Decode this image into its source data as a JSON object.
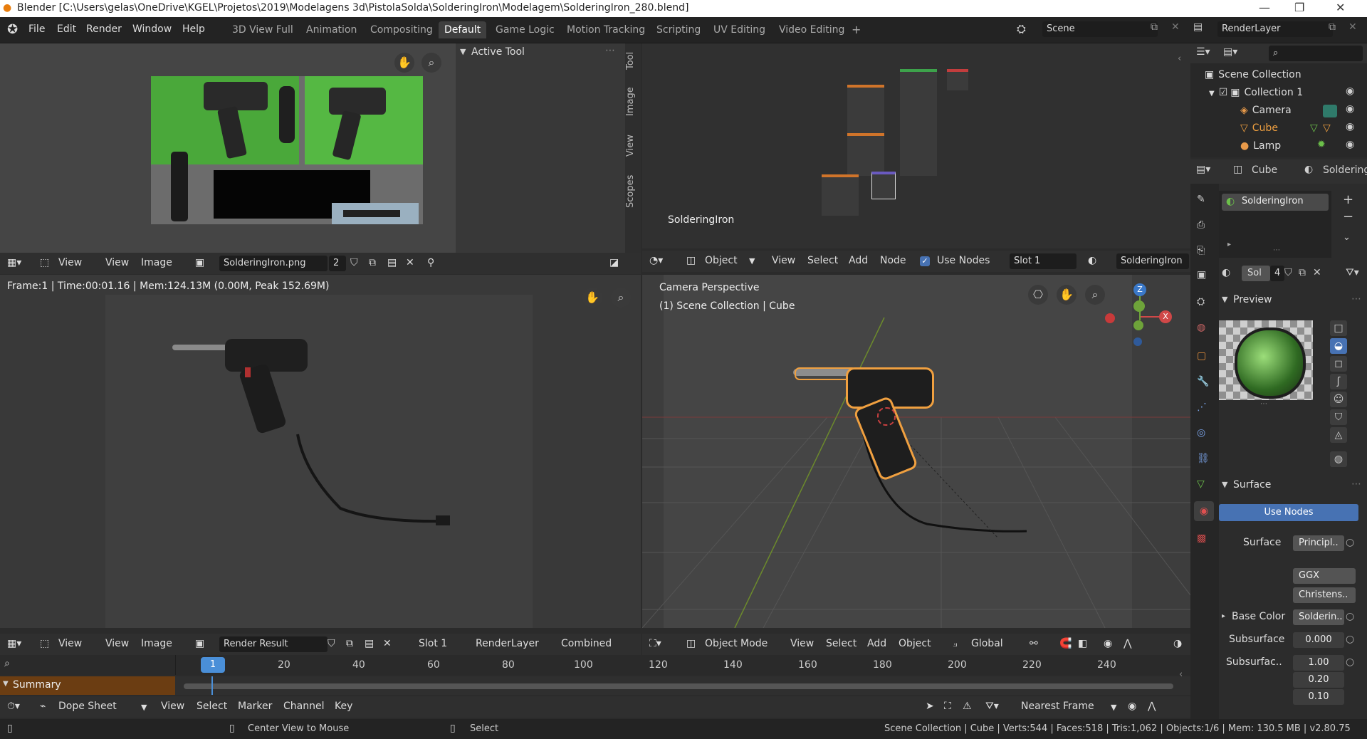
{
  "titlebar": {
    "title": "Blender [C:\\Users\\gelas\\OneDrive\\KGEL\\Projetos\\2019\\Modelagens 3d\\PistolaSolda\\SolderingIron\\Modelagem\\SolderingIron_280.blend]"
  },
  "menu": [
    "File",
    "Edit",
    "Render",
    "Window",
    "Help"
  ],
  "workspaces": [
    "3D View Full",
    "Animation",
    "Compositing",
    "Default",
    "Game Logic",
    "Motion Tracking",
    "Scripting",
    "UV Editing",
    "Video Editing"
  ],
  "workspace_active": "Default",
  "scene": {
    "label": "Scene",
    "renderlayer": "RenderLayer"
  },
  "image_editor_top": {
    "tool_panel_title": "Active Tool",
    "side_tabs": [
      "Tool",
      "Image",
      "View",
      "Scopes"
    ],
    "header": {
      "view1": "View",
      "view2": "View",
      "image": "Image",
      "image_name": "SolderingIron.png",
      "users": "2"
    }
  },
  "node_editor": {
    "material_label": "SolderingIron",
    "header": {
      "object": "Object",
      "view": "View",
      "select": "Select",
      "add": "Add",
      "node": "Node",
      "use_nodes": "Use Nodes",
      "slot": "Slot 1",
      "material": "SolderingIron"
    }
  },
  "render_view": {
    "info": "Frame:1 | Time:00:01.16 | Mem:124.13M (0.00M, Peak 152.69M)",
    "header": {
      "view1": "View",
      "view2": "View",
      "image": "Image",
      "image_name": "Render Result",
      "slot": "Slot 1",
      "layer": "RenderLayer",
      "pass": "Combined"
    }
  },
  "viewport": {
    "title": "Camera Perspective",
    "subtitle": "(1) Scene Collection | Cube",
    "header": {
      "mode": "Object Mode",
      "view": "View",
      "select": "Select",
      "add": "Add",
      "object": "Object",
      "orientation": "Global"
    },
    "gizmo": {
      "z": "Z",
      "x": "X"
    }
  },
  "outliner": {
    "items": [
      {
        "label": "Scene Collection",
        "color": "#dddddd"
      },
      {
        "label": "Collection 1",
        "color": "#dddddd"
      },
      {
        "label": "Camera",
        "color": "#dddddd"
      },
      {
        "label": "Cube",
        "color": "#f0a040"
      },
      {
        "label": "Lamp",
        "color": "#dddddd"
      }
    ]
  },
  "properties": {
    "breadcrumb": {
      "object": "Cube",
      "material": "Soldering"
    },
    "material_slot": "SolderingIron",
    "datablock_name": "Sol",
    "datablock_users": "4",
    "preview_title": "Preview",
    "surface_title": "Surface",
    "use_nodes_btn": "Use Nodes",
    "rows": [
      {
        "label": "Surface",
        "value": "Principl.."
      },
      {
        "label": "",
        "value": "GGX"
      },
      {
        "label": "",
        "value": "Christens.."
      },
      {
        "label": "Base Color",
        "value": "Solderin.."
      },
      {
        "label": "Subsurface",
        "value": "0.000"
      },
      {
        "label": "Subsurfac..",
        "value": "1.00"
      },
      {
        "label": "",
        "value": "0.20"
      },
      {
        "label": "",
        "value": "0.10"
      }
    ]
  },
  "timeline": {
    "current_frame": "1",
    "ticks": [
      "20",
      "40",
      "60",
      "80",
      "100",
      "120",
      "140",
      "160",
      "180",
      "200",
      "220",
      "240"
    ],
    "summary": "Summary"
  },
  "dopesheet": {
    "editor": "Dope Sheet",
    "menu": [
      "View",
      "Select",
      "Marker",
      "Channel",
      "Key"
    ],
    "snap": "Nearest Frame"
  },
  "status": {
    "center": "Center View to Mouse",
    "select": "Select",
    "stats": "Scene Collection | Cube | Verts:544 | Faces:518 | Tris:1,062 | Objects:1/6 | Mem: 130.5 MB | v2.80.75"
  },
  "colors": {
    "accent": "#4772b3",
    "active_orange": "#f0a040",
    "frame_blue": "#4a8fd8"
  }
}
